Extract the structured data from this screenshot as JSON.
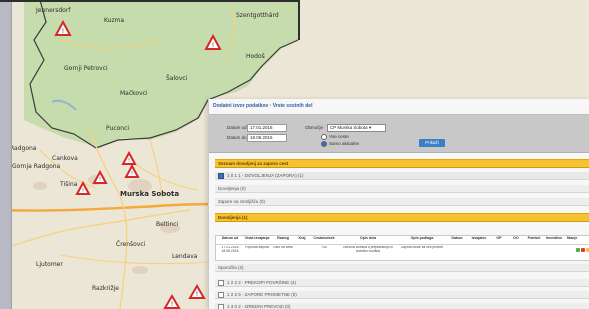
{
  "colors": {
    "sidebar": "#b9b9c6",
    "map_land": "#ece6d6",
    "map_park": "#c7dcac",
    "border_line": "#3a3a3a",
    "road_major": "#f3a93b",
    "road_minor": "#f5d27e",
    "window_bg": "#f7f7f7",
    "filter_bg": "#c8c8c8",
    "accent_bar": "#f5c231",
    "button": "#3d7fc6",
    "warning_sign": "#d62828"
  },
  "map": {
    "labels": {
      "top_left": "Jennersdorf",
      "top_right": "Szentgotthárd",
      "top_mid": "Kuzma",
      "mid_a": "Gornji Petrovci",
      "mid_b": "Mačkovci",
      "mid_c": "Šalovci",
      "mid_d": "Hodoš",
      "center": "Puconci",
      "city": "Murska Sobota",
      "left_a": "Radgona",
      "left_b": "Gornja Radgona",
      "left_c": "Cankova",
      "left_d": "Tišina",
      "bottom_a": "Beltinci",
      "bottom_b": "Lendava",
      "bottom_c": "Ljutomer",
      "bottom_d": "Razkrižje",
      "bottom_e": "Črenšovci"
    }
  },
  "window": {
    "title": "Dodatni izvor podatkov · Vrste cestnih del",
    "filter": {
      "from_label": "Datum od",
      "from_value": "17.01.2016",
      "to_label": "Datum do",
      "to_value": "18.06.2016",
      "region_label": "Območje",
      "region_value": "CP Murska Sobota",
      "radio_1": "Vse ceste",
      "radio_2": "Samo aktualne",
      "apply": "Prikaži"
    },
    "bar_1": "Seznam dovoljenj za zaporo cest",
    "bar_2": "1 0 1 1 - DOVOLJENJA (ZAPORA) (1)",
    "row_1": "Dovoljenja (0)",
    "row_2": "Zapore na zemljišču (0)",
    "bar_3": "Dovoljenja (1)",
    "table": {
      "headers": [
        "Datum od",
        "Vrsta izvajanja",
        "Razlog",
        "Kraj",
        "Cesta/odsek",
        "Opis dela",
        "Opis podlaga",
        "Datum",
        "Izvajalec",
        "OP",
        "DO",
        "Potekel",
        "Investitor",
        "Stanje"
      ],
      "cells": [
        "17.01.2016 18.06.2016",
        "Popolna zapora",
        "Delo na cesti",
        "",
        "793",
        "Obnova vozišča s preplastitvijo in izvedbo vozišča",
        "Zapora ceste za ves promet",
        "",
        "",
        "",
        "",
        "",
        "",
        ""
      ]
    },
    "row_3": "Sporočila (2)",
    "row_4": "1 2 2 2 - PREKOPI POVRŠINE (4)",
    "row_5": "1 2 2 5 - ZAPORE PROMETNE (5)",
    "row_6": "1 3 0 2 - IZREDNI PREVOZI (0)"
  }
}
